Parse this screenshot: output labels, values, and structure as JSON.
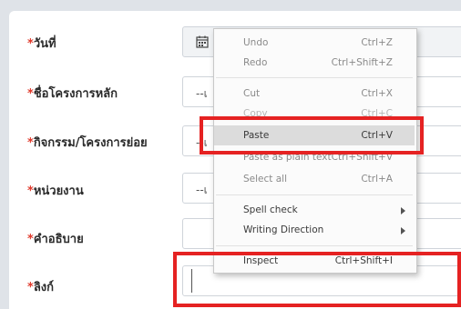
{
  "form": {
    "rows": [
      {
        "label": "วันที่",
        "required_mark": "*",
        "value": ""
      },
      {
        "label": "ชื่อโครงการหลัก",
        "required_mark": "*",
        "placeholder": "--เ"
      },
      {
        "label": "กิจกรรม/โครงการย่อย",
        "required_mark": "*",
        "placeholder": "--เ"
      },
      {
        "label": "หน่วยงาน",
        "required_mark": "*",
        "placeholder": "--เ"
      },
      {
        "label": "คำอธิบาย",
        "required_mark": "*",
        "value": ""
      },
      {
        "label": "ลิงก์",
        "required_mark": "*",
        "value": ""
      }
    ]
  },
  "context_menu": {
    "items": [
      {
        "label": "Undo",
        "shortcut": "Ctrl+Z"
      },
      {
        "label": "Redo",
        "shortcut": "Ctrl+Shift+Z"
      },
      {
        "label": "Cut",
        "shortcut": "Ctrl+X"
      },
      {
        "label": "Copy",
        "shortcut": "Ctrl+C"
      },
      {
        "label": "Paste",
        "shortcut": "Ctrl+V"
      },
      {
        "label": "Paste as plain text",
        "shortcut": "Ctrl+Shift+V"
      },
      {
        "label": "Select all",
        "shortcut": "Ctrl+A"
      },
      {
        "label": "Spell check",
        "shortcut": ""
      },
      {
        "label": "Writing Direction",
        "shortcut": ""
      },
      {
        "label": "Inspect",
        "shortcut": "Ctrl+Shift+I"
      }
    ],
    "highlighted_item": "Paste"
  },
  "icons": {
    "date_field_icon": "calendar-icon",
    "submenu_icon": "chevron-right-icon"
  },
  "colors": {
    "required": "#e0392b",
    "annotation_highlight": "#e52222",
    "menu_hover": "#dcdcdc"
  }
}
